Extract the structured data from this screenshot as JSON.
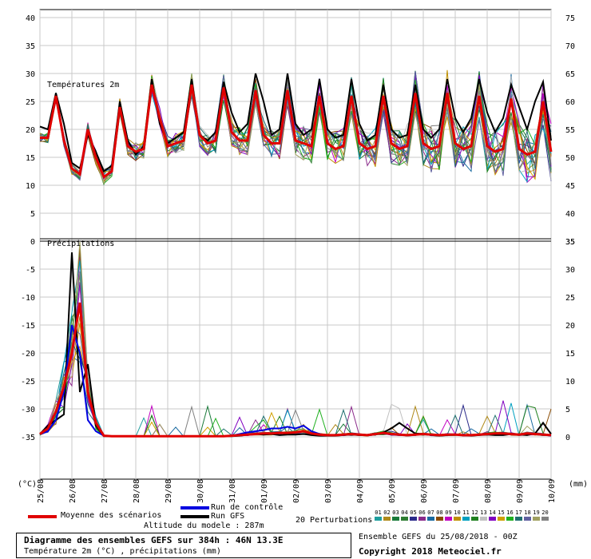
{
  "chart_data": {
    "type": "line",
    "dates": [
      "25/08",
      "26/08",
      "27/08",
      "28/08",
      "29/08",
      "30/08",
      "31/08",
      "01/09",
      "02/09",
      "03/09",
      "04/09",
      "05/09",
      "06/09",
      "07/09",
      "08/09",
      "09/09",
      "10/09"
    ],
    "temperature": {
      "title": "Températures 2m",
      "ylim": [
        0,
        40
      ],
      "right_ylim": [
        35,
        75
      ],
      "yticks": [
        "40",
        "35",
        "30",
        "25",
        "20",
        "15",
        "10",
        "5",
        "0"
      ],
      "right_yticks": [
        "75",
        "70",
        "65",
        "60",
        "55",
        "50",
        "45",
        "40",
        "35"
      ],
      "x": [
        0,
        0.25,
        0.5,
        0.75,
        1,
        1.25,
        1.5,
        1.75,
        2,
        2.25,
        2.5,
        2.75,
        3,
        3.25,
        3.5,
        3.75,
        4,
        4.25,
        4.5,
        4.75,
        5,
        5.25,
        5.5,
        5.75,
        6,
        6.25,
        6.5,
        6.75,
        7,
        7.25,
        7.5,
        7.75,
        8,
        8.25,
        8.5,
        8.75,
        9,
        9.25,
        9.5,
        9.75,
        10,
        10.25,
        10.5,
        10.75,
        11,
        11.25,
        11.5,
        11.75,
        12,
        12.25,
        12.5,
        12.75,
        13,
        13.25,
        13.5,
        13.75,
        14,
        14.25,
        14.5,
        14.75,
        15,
        15.25,
        15.5,
        15.75,
        16
      ],
      "mean": [
        18.5,
        18.5,
        26,
        18,
        13,
        12,
        20,
        15,
        11.5,
        12.5,
        24,
        17,
        16,
        16.5,
        28,
        22,
        17,
        17.5,
        18,
        28,
        19,
        17.5,
        18,
        27.5,
        19.5,
        18,
        18,
        27,
        19,
        17.5,
        17.5,
        27,
        18,
        17.5,
        17,
        26,
        17.5,
        16.5,
        17,
        26,
        17.5,
        16.5,
        17,
        26,
        17.5,
        16.5,
        17,
        26.5,
        17.5,
        16.5,
        17,
        26.5,
        17.5,
        16.5,
        17,
        26,
        17,
        16,
        16.5,
        25.5,
        16.5,
        15.5,
        16,
        25,
        16
      ],
      "gfs": [
        20.5,
        20,
        26.5,
        21,
        14,
        13,
        19,
        16,
        12.5,
        13.5,
        25,
        18,
        15.5,
        17,
        29,
        21,
        17.5,
        18.5,
        19.5,
        29,
        19,
        18,
        19.5,
        28.5,
        23,
        19.5,
        21,
        30,
        25,
        19,
        20,
        30,
        21,
        19,
        20,
        29,
        20,
        18.5,
        19,
        29,
        21,
        18,
        19,
        28,
        20,
        18.5,
        19,
        28,
        20,
        18.5,
        20,
        29,
        22,
        19.5,
        22,
        29,
        23,
        19.5,
        22,
        28,
        24,
        20,
        25,
        28.5,
        18
      ]
    },
    "precipitation": {
      "title": "Précipitations",
      "ylim": [
        0,
        35
      ],
      "yticks": [
        "0",
        "-5",
        "-10",
        "-15",
        "-20",
        "-25",
        "-30",
        "-35"
      ],
      "right_yticks": [
        "35",
        "30",
        "25",
        "20",
        "15",
        "10",
        "5",
        "0"
      ],
      "mean_mm": [
        0.5,
        1.5,
        4.5,
        9,
        15,
        24,
        8,
        2.5,
        0.2,
        0.1,
        0.1,
        0.1,
        0.1,
        0.1,
        0.1,
        0.1,
        0.1,
        0.1,
        0.1,
        0.1,
        0.1,
        0.1,
        0.1,
        0.1,
        0.2,
        0.3,
        0.4,
        0.5,
        0.6,
        0.6,
        0.7,
        0.7,
        0.8,
        1,
        0.6,
        0.4,
        0.3,
        0.3,
        0.4,
        0.5,
        0.4,
        0.3,
        0.5,
        0.7,
        0.5,
        0.4,
        0.3,
        0.4,
        0.5,
        0.4,
        0.3,
        0.4,
        0.4,
        0.3,
        0.3,
        0.4,
        0.5,
        0.6,
        0.6,
        0.5,
        0.4,
        0.6,
        0.5,
        0.4,
        0.3
      ],
      "control_mm": [
        0.5,
        1,
        3,
        8,
        20,
        15,
        3,
        1,
        0.2,
        0.1,
        0.1,
        0.1,
        0.1,
        0.1,
        0.1,
        0.1,
        0.1,
        0.1,
        0.1,
        0.1,
        0.1,
        0.1,
        0.1,
        0.1,
        0.2,
        0.5,
        0.8,
        1,
        1.2,
        1.5,
        1.5,
        1.8,
        1.5,
        2,
        1,
        0.5,
        0.3,
        0.3,
        0.3,
        0.5,
        0.4,
        0.3,
        0.5,
        0.6,
        0.4,
        0.3,
        0.3,
        0.4,
        0.5,
        0.3,
        0.3,
        0.5,
        0.4,
        0.3,
        0.3,
        0.4,
        0.5,
        0.6,
        0.7,
        0.5,
        0.4,
        0.6,
        0.5,
        0.4,
        0.2
      ],
      "gfs_mm": [
        0.5,
        2,
        3,
        4,
        33,
        8,
        13,
        2,
        0.1,
        0.1,
        0.1,
        0.1,
        0.1,
        0.1,
        0.1,
        0.1,
        0.1,
        0.1,
        0.1,
        0.1,
        0.1,
        0.1,
        0.1,
        0.1,
        0.1,
        0.2,
        0.4,
        0.5,
        0.4,
        0.5,
        0.3,
        0.4,
        0.4,
        0.5,
        0.3,
        0.2,
        0.2,
        0.2,
        0.3,
        0.4,
        0.3,
        0.3,
        0.4,
        0.8,
        1.5,
        2.5,
        1.5,
        0.6,
        0.5,
        0.3,
        0.2,
        0.3,
        0.4,
        0.3,
        0.2,
        0.3,
        0.4,
        0.3,
        0.3,
        0.5,
        0.4,
        0.3,
        0.6,
        2.5,
        0.5
      ]
    }
  },
  "labels": {
    "unit_c": "(°C)",
    "unit_mm": "(mm)",
    "mean_label": "Moyenne des scénarios",
    "control_label": "Run de contrôle",
    "gfs_label": "Run GFS",
    "perturbations_label": "20 Perturbations",
    "altitude": "Altitude du modele : 287m",
    "box_title": "Diagramme des ensembles GEFS sur 384h : 46N 13.3E",
    "box_subtitle": "Température 2m (°C) , précipitations (mm)",
    "run_info": "Ensemble GEFS du 25/08/2018 - 00Z",
    "copyright": "Copyright 2018 Meteociel.fr"
  },
  "perturbations": [
    {
      "num": "01",
      "color": "#1f9e9e"
    },
    {
      "num": "02",
      "color": "#b08a1a"
    },
    {
      "num": "03",
      "color": "#1a7a3a"
    },
    {
      "num": "04",
      "color": "#2e7d32"
    },
    {
      "num": "05",
      "color": "#2a2a8a"
    },
    {
      "num": "06",
      "color": "#8a2a8a"
    },
    {
      "num": "07",
      "color": "#1a6aa0"
    },
    {
      "num": "08",
      "color": "#8a4a00"
    },
    {
      "num": "09",
      "color": "#c000c0"
    },
    {
      "num": "10",
      "color": "#c09000"
    },
    {
      "num": "11",
      "color": "#00a0c0"
    },
    {
      "num": "12",
      "color": "#208020"
    },
    {
      "num": "13",
      "color": "#c0c0c0"
    },
    {
      "num": "14",
      "color": "#8000c0"
    },
    {
      "num": "15",
      "color": "#d0a000"
    },
    {
      "num": "16",
      "color": "#20b020"
    },
    {
      "num": "17",
      "color": "#207070"
    },
    {
      "num": "18",
      "color": "#6060a0"
    },
    {
      "num": "19",
      "color": "#a0a060"
    },
    {
      "num": "20",
      "color": "#808080"
    }
  ],
  "colors": {
    "mean": "#e00000",
    "control": "#0000e0",
    "gfs": "#000000"
  }
}
